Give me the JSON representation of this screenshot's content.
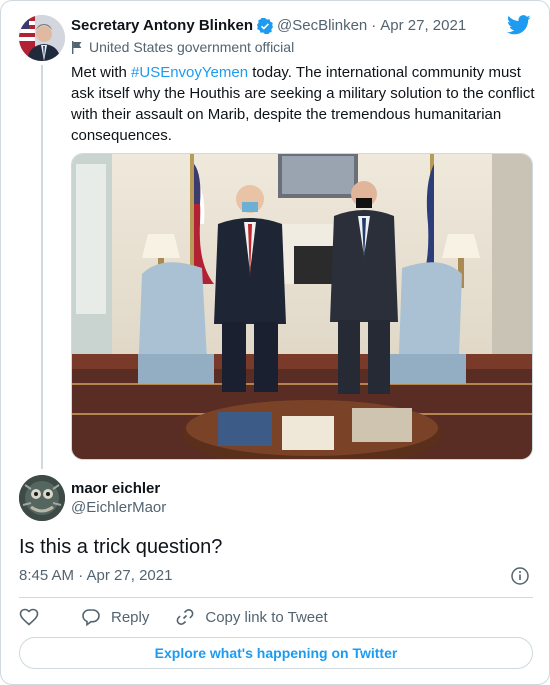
{
  "quoted_tweet": {
    "author_name": "Secretary Antony Blinken",
    "handle": "@SecBlinken",
    "separator": "·",
    "date": "Apr 27, 2021",
    "label": "United States government official",
    "text_before": "Met with ",
    "hashtag": "#USEnvoyYemen",
    "text_after": " today. The international community must ask itself why the Houthis are seeking a military solution to the conflict with their assault on Marib, despite the tremendous humanitarian consequences."
  },
  "reply_tweet": {
    "author_name": "maor eichler",
    "handle": "@EichlerMaor",
    "text": "Is this a trick question?",
    "timestamp": "8:45 AM · Apr 27, 2021"
  },
  "actions": {
    "reply_label": "Reply",
    "copy_link_label": "Copy link to Tweet"
  },
  "explore_label": "Explore what's happening on Twitter",
  "colors": {
    "accent": "#1d9bf0",
    "text": "#0f1419",
    "muted": "#536471",
    "border": "#cfd9de"
  },
  "icons": [
    "twitter-bird-icon",
    "verified-badge-icon",
    "flag-icon",
    "info-icon",
    "heart-icon",
    "reply-icon",
    "link-icon"
  ]
}
